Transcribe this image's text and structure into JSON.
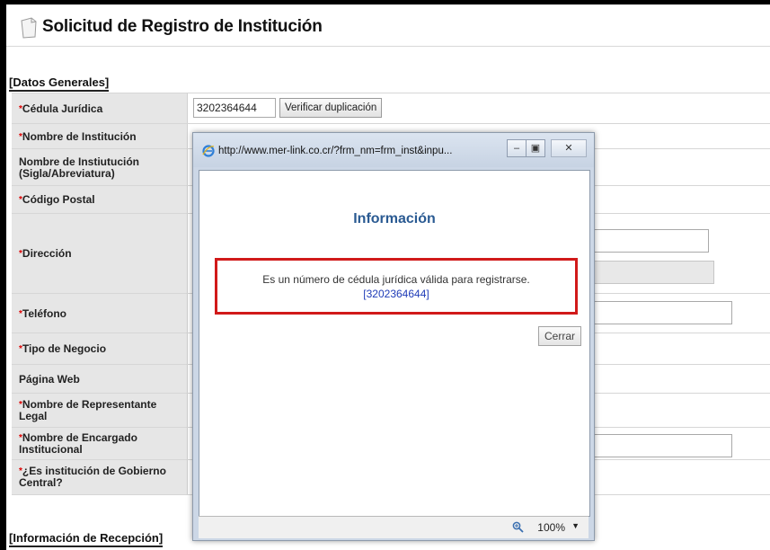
{
  "page": {
    "title": "Solicitud de Registro de Institución",
    "section_general": "[Datos Generales]",
    "section_reception": "[Información de Recepción]"
  },
  "form": {
    "rows": [
      {
        "label": "Cédula Jurídica",
        "required": true
      },
      {
        "label": "Nombre de Institución",
        "required": true
      },
      {
        "label": "Nombre de Instiutución (Sigla/Abreviatura)",
        "required": false
      },
      {
        "label": "Código Postal",
        "required": true
      },
      {
        "label": "Dirección",
        "required": true
      },
      {
        "label": "Teléfono",
        "required": true
      },
      {
        "label": "Tipo de Negocio",
        "required": true
      },
      {
        "label": "Página Web",
        "required": false
      },
      {
        "label": "Nombre de Representante Legal",
        "required": true
      },
      {
        "label": "Nombre de Encargado Institucional",
        "required": true
      },
      {
        "label": "¿Es institución de Gobierno Central?",
        "required": true
      }
    ],
    "cedula_value": "3202364644",
    "verify_button": "Verificar duplicación",
    "required_mark": "*"
  },
  "popup": {
    "url": "http://www.mer-link.co.cr/?frm_nm=frm_inst&inpu...",
    "title": "Información",
    "message": "Es un número de cédula jurídica válida para registrarse.",
    "number": "[3202364644]",
    "close_button": "Cerrar",
    "zoom": "100%",
    "window_buttons": [
      "minimize-icon",
      "maximize-icon",
      "close-icon"
    ]
  },
  "colors": {
    "label_bg": "#e6e6e6",
    "required": "#d00000",
    "info_title": "#2a5a92",
    "highlight_border": "#d11a1a",
    "number_link": "#1f3cb8"
  }
}
